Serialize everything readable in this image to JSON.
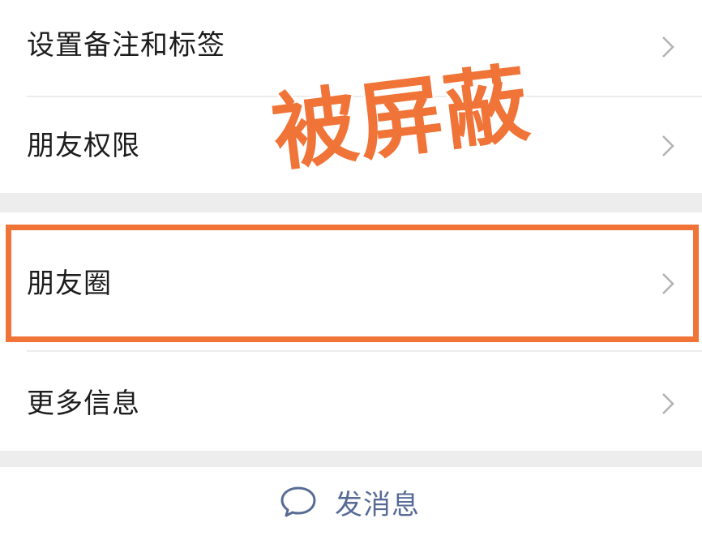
{
  "menu": {
    "items": [
      {
        "label": "设置备注和标签"
      },
      {
        "label": "朋友权限"
      },
      {
        "label": "朋友圈"
      },
      {
        "label": "更多信息"
      }
    ]
  },
  "overlay": {
    "stamp_text": "被屏蔽",
    "accent_color": "#f07337"
  },
  "actions": {
    "send_message_label": "发消息"
  },
  "icons": {
    "chevron": "chevron-right-icon",
    "message": "message-bubble-icon"
  },
  "colors": {
    "background": "#ffffff",
    "section_gap": "#ededed",
    "link_blue": "#576b95",
    "chevron": "#b2b2b2"
  }
}
